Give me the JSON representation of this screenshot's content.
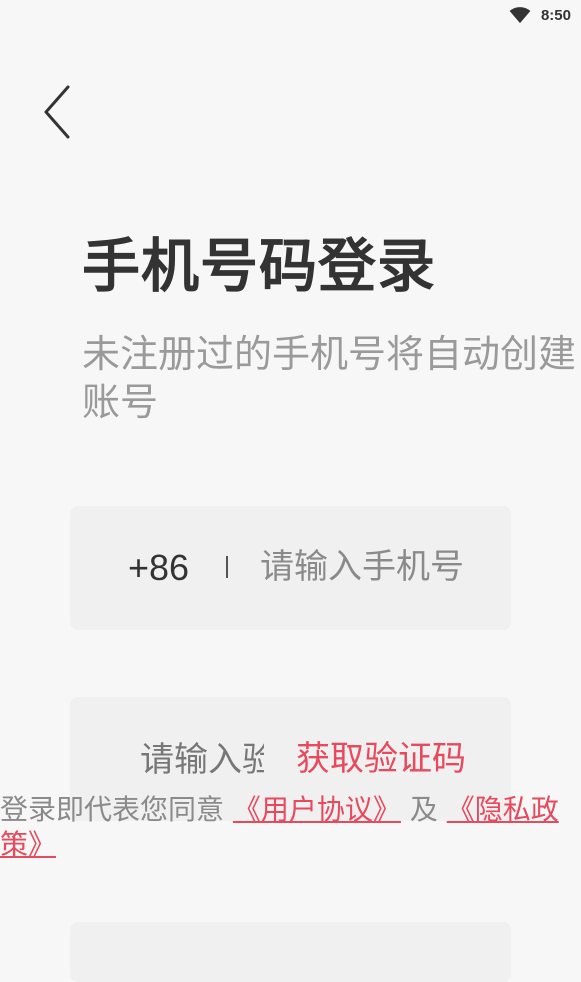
{
  "status_bar": {
    "time": "8:50",
    "wifi_icon": "wifi-icon"
  },
  "back_icon": "chevron-left-icon",
  "title": "手机号码登录",
  "subtitle": "未注册过的手机号将自动创建账号",
  "phone": {
    "country_code": "+86",
    "placeholder": "请输入手机号"
  },
  "code": {
    "placeholder": "请输入验证码",
    "get_code_label": "获取验证码"
  },
  "agreement": {
    "prefix": "登录即代表您同意",
    "user_agreement": "《用户协议》",
    "conjunction": "及",
    "privacy_policy": "《隐私政策》"
  },
  "colors": {
    "accent": "#e8495c",
    "background": "#f7f7f7",
    "card": "#f0f0f0"
  }
}
